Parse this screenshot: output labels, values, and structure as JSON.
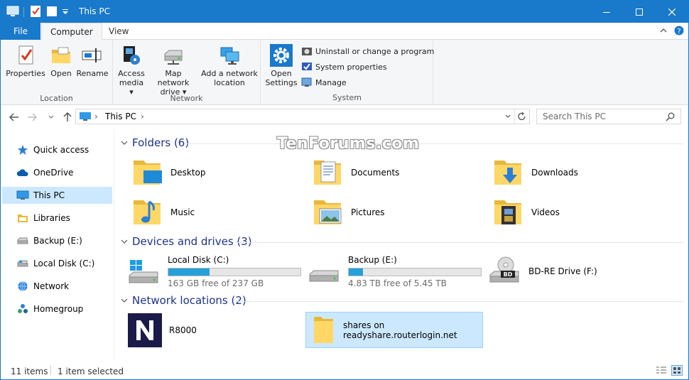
{
  "window": {
    "title": "This PC"
  },
  "ribbon": {
    "tabs": {
      "file": "File",
      "computer": "Computer",
      "view": "View"
    },
    "location": {
      "label": "Location",
      "properties": "Properties",
      "open": "Open",
      "rename": "Rename"
    },
    "network": {
      "label": "Network",
      "access_media_1": "Access",
      "access_media_2": "media",
      "map_drive_1": "Map network",
      "map_drive_2": "drive",
      "add_location_1": "Add a network",
      "add_location_2": "location"
    },
    "system": {
      "label": "System",
      "open_settings_1": "Open",
      "open_settings_2": "Settings",
      "uninstall": "Uninstall or change a program",
      "system_properties": "System properties",
      "manage": "Manage"
    }
  },
  "address": {
    "breadcrumb": "This PC",
    "search_placeholder": "Search This PC"
  },
  "sidebar": {
    "items": [
      {
        "label": "Quick access"
      },
      {
        "label": "OneDrive"
      },
      {
        "label": "This PC"
      },
      {
        "label": "Libraries"
      },
      {
        "label": "Backup (E:)"
      },
      {
        "label": "Local Disk (C:)"
      },
      {
        "label": "Network"
      },
      {
        "label": "Homegroup"
      }
    ]
  },
  "groups": {
    "folders": "Folders (6)",
    "devices": "Devices and drives (3)",
    "network": "Network locations (2)"
  },
  "folders": [
    {
      "name": "Desktop"
    },
    {
      "name": "Documents"
    },
    {
      "name": "Downloads"
    },
    {
      "name": "Music"
    },
    {
      "name": "Pictures"
    },
    {
      "name": "Videos"
    }
  ],
  "drives": [
    {
      "name": "Local Disk (C:)",
      "free": "163 GB free of 237 GB",
      "used_fraction": 0.31
    },
    {
      "name": "Backup (E:)",
      "free": "4.83 TB free of 5.45 TB",
      "used_fraction": 0.11
    },
    {
      "name": "BD-RE Drive (F:)"
    }
  ],
  "network_locations": [
    {
      "name": "R8000"
    },
    {
      "name_1": "shares on",
      "name_2": "readyshare.routerlogin.net"
    }
  ],
  "status": {
    "count": "11 items",
    "selected": "1 item selected"
  },
  "watermark": "TenForums.com",
  "colors": {
    "accent": "#1979ca",
    "selection": "#cce8ff",
    "group_heading": "#1e3287",
    "drive_fill": "#26a0da"
  }
}
